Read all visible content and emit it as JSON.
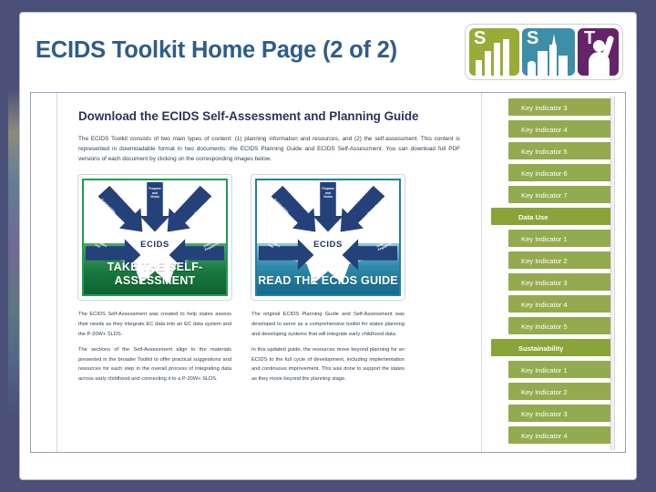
{
  "slide": {
    "title": "ECIDS Toolkit Home Page (2 of 2)",
    "title_color": "#2e5d88"
  },
  "logo": {
    "name": "sst-logo",
    "panels": [
      {
        "letter": "S",
        "glyph": "bar-chart",
        "color": "#9aab38"
      },
      {
        "letter": "S",
        "glyph": "city-skyline",
        "color": "#3d8fa8"
      },
      {
        "letter": "T",
        "glyph": "person-raising-hand",
        "color": "#65246a"
      }
    ]
  },
  "article": {
    "heading": "Download the ECIDS Self-Assessment and Planning Guide",
    "intro": "The ECIDS Toolkit consists of two main types of content: (1) planning information and resources, and (2) the self-assessment. This content is represented in downloadable format in two documents: the ECIDS Planning Guide and ECIDS Self-Assessment. You can download full PDF versions of each document by clicking on the corresponding images below."
  },
  "cards": [
    {
      "id": "take-the-self-assessment",
      "caption": "TAKE THE\nSELF-ASSESSMENT",
      "center_label": "ECIDS",
      "accent": "#1f9c52",
      "arrow_labels": {
        "top": "Purpose\nand\nVision",
        "top_left": "Sustainability",
        "top_right": "Governing and\nManagement",
        "bottom_left": "Information\nUse",
        "bottom_right": "Stakeholder\nEngagement"
      }
    },
    {
      "id": "read-the-ecids-guide",
      "caption": "READ THE\nECIDS GUIDE",
      "center_label": "ECIDS",
      "accent": "#1f7fa8",
      "arrow_labels": {
        "top": "Purpose\nand\nVision",
        "top_left": "Sustainability",
        "top_right": "Governing and\nManagement",
        "bottom_left": "Information\nUse",
        "bottom_right": "Stakeholder\nEngagement"
      }
    }
  ],
  "descriptions": [
    {
      "id": "self-assessment-description",
      "paragraphs": [
        "The ECIDS Self-Assessment was created to help states assess their needs as they integrate EC data into an EC data system and the P-20W+ SLDS.",
        "The sections of the Self-Assessment align to the materials presented in the broader Toolkit to offer practical suggestions and resources for each step in the overall process of integrating data across early childhood and connecting it to a P-20W+ SLDS."
      ]
    },
    {
      "id": "planning-guide-description",
      "paragraphs": [
        "The original ECIDS Planning Guide and Self-Assessment was developed to serve as a comprehensive toolkit for states planning and developing systems that will integrate early childhood data.",
        "In this updated guide, the resources move beyond planning for an ECIDS to the full cycle of development, including implementation and continuous improvement. This was done to support the states as they move beyond the planning stage."
      ]
    }
  ],
  "sidebar": {
    "accent": "#8ba83c",
    "items": [
      {
        "label": "Key Indicator 3",
        "type": "indicator"
      },
      {
        "label": "Key Indicator 4",
        "type": "indicator"
      },
      {
        "label": "Key Indicator 5",
        "type": "indicator"
      },
      {
        "label": "Key Indicator 6",
        "type": "indicator"
      },
      {
        "label": "Key Indicator 7",
        "type": "indicator"
      },
      {
        "label": "Data Use",
        "type": "section"
      },
      {
        "label": "Key Indicator 1",
        "type": "indicator"
      },
      {
        "label": "Key Indicator 2",
        "type": "indicator"
      },
      {
        "label": "Key Indicator 3",
        "type": "indicator"
      },
      {
        "label": "Key Indicator 4",
        "type": "indicator"
      },
      {
        "label": "Key Indicator 5",
        "type": "indicator"
      },
      {
        "label": "Sustainability",
        "type": "section"
      },
      {
        "label": "Key Indicator 1",
        "type": "indicator"
      },
      {
        "label": "Key Indicator 2",
        "type": "indicator"
      },
      {
        "label": "Key Indicator 3",
        "type": "indicator"
      },
      {
        "label": "Key Indicator 4",
        "type": "indicator"
      }
    ]
  }
}
